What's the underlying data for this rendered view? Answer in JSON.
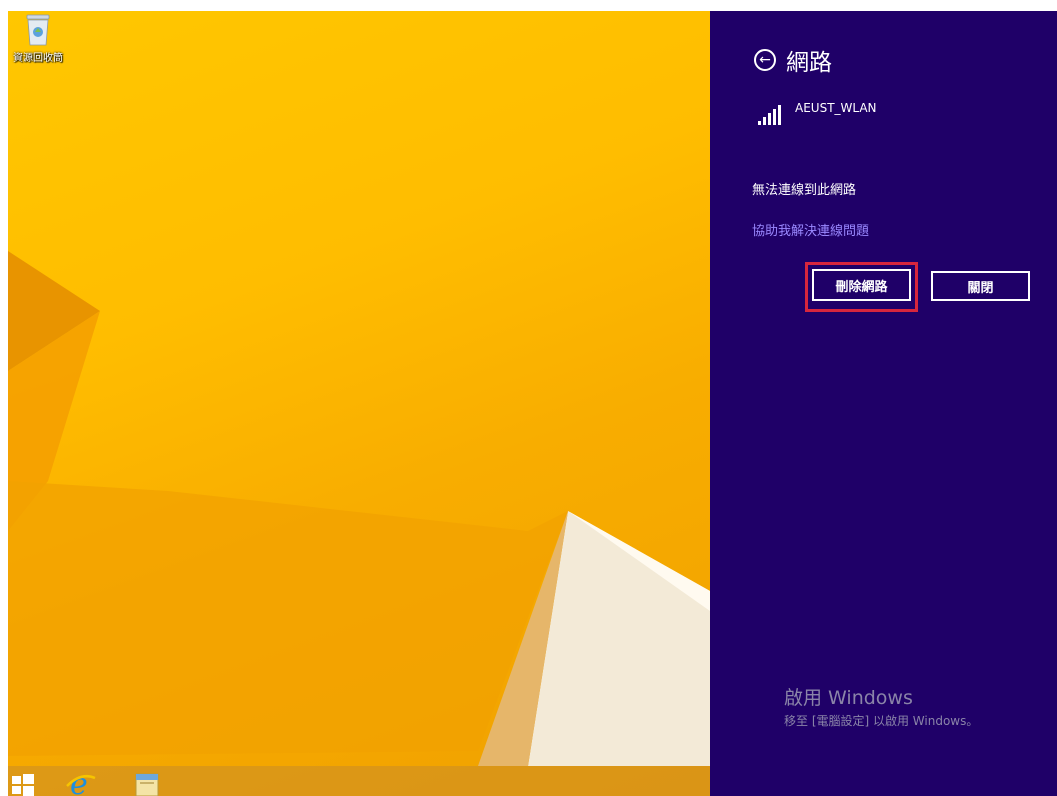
{
  "desktop": {
    "icons": [
      {
        "label": "資源回收筒",
        "icon": "recycle-bin-icon"
      }
    ]
  },
  "taskbar": {
    "items": [
      {
        "name": "start-button",
        "icon": "windows-logo-icon"
      },
      {
        "name": "internet-explorer",
        "icon": "ie-icon"
      },
      {
        "name": "file-explorer",
        "icon": "folder-icon"
      }
    ]
  },
  "charm": {
    "title": "網路",
    "back_icon": "back-arrow-icon",
    "network": {
      "name": "AEUST_WLAN",
      "icon": "wifi-signal-icon"
    },
    "status": "無法連線到此網路",
    "help_link": "協助我解決連線問題",
    "forget_label": "刪除網路",
    "close_label": "關閉",
    "watermark_title": "啟用 Windows",
    "watermark_sub": "移至 [電腦設定] 以啟用 Windows。"
  },
  "colors": {
    "charm_bg": "#1f0068",
    "link": "#9a88ff",
    "highlight": "#d7263d",
    "wallpaper": "#ffc700"
  }
}
